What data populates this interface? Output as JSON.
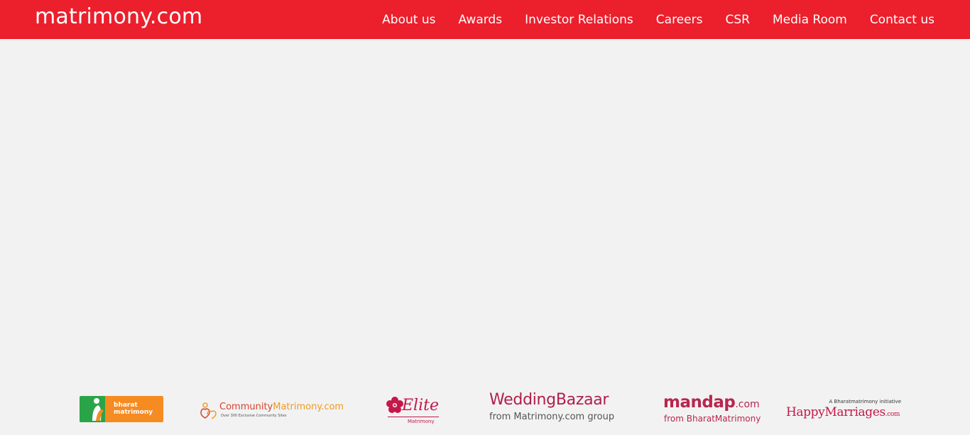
{
  "header": {
    "logo": "matrimony.com",
    "nav": [
      {
        "label": "About us"
      },
      {
        "label": "Awards"
      },
      {
        "label": "Investor Relations"
      },
      {
        "label": "Careers"
      },
      {
        "label": "CSR"
      },
      {
        "label": "Media Room"
      },
      {
        "label": "Contact us"
      }
    ]
  },
  "brands": {
    "bharat": {
      "line1": "bharat",
      "line2": "matrimony"
    },
    "community": {
      "part1": "Community",
      "part2": "Matrimony.com",
      "sub": "Over 300 Exclusive Community Sites"
    },
    "elite": {
      "title": "Elite",
      "sub": "Matrimony"
    },
    "weddingbazaar": {
      "title": "WeddingBazaar",
      "sub": "from Matrimony.com group"
    },
    "mandap": {
      "title": "mandap",
      "suffix": ".com",
      "sub": "from BharatMatrimony"
    },
    "happymarriages": {
      "top": "A Bharatmatrimony initiative",
      "title": "HappyMarriages",
      "suffix": ".com"
    }
  },
  "colors": {
    "header_bg": "#ec1f2c",
    "page_bg": "#f2f2f2",
    "brand_pink": "#c4174a"
  }
}
